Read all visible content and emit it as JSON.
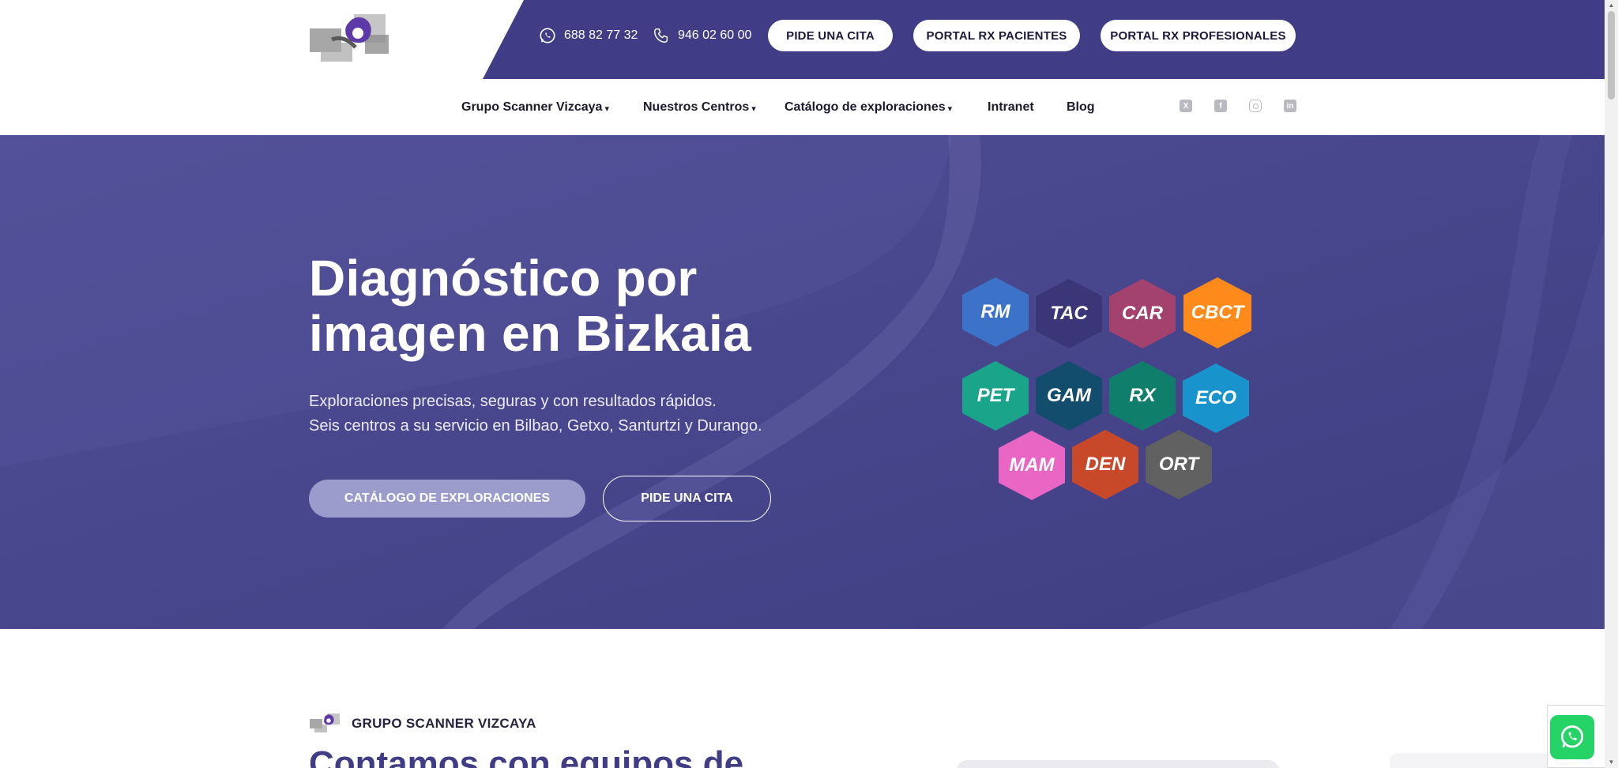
{
  "header": {
    "whatsapp_phone": "688 82 77 32",
    "phone": "946 02 60 00",
    "buttons": {
      "cita": "PIDE UNA CITA",
      "portal_pacientes": "PORTAL RX PACIENTES",
      "portal_profesionales": "PORTAL RX PROFESIONALES"
    }
  },
  "nav": {
    "items": [
      {
        "label": "Grupo Scanner Vizcaya",
        "dropdown": true
      },
      {
        "label": "Nuestros Centros",
        "dropdown": true
      },
      {
        "label": "Catálogo de exploraciones",
        "dropdown": true
      },
      {
        "label": "Intranet",
        "dropdown": false
      },
      {
        "label": "Blog",
        "dropdown": false
      }
    ],
    "social": [
      "x-icon",
      "facebook-icon",
      "instagram-icon",
      "linkedin-icon"
    ]
  },
  "hero": {
    "title_line1": "Diagnóstico por",
    "title_line2": "imagen en Bizkaia",
    "subtitle_line1": "Exploraciones precisas, seguras y con resultados rápidos.",
    "subtitle_line2": "Seis centros a su servicio en Bilbao, Getxo, Santurtzi y Durango.",
    "btn_catalog": "CATÁLOGO DE EXPLORACIONES",
    "btn_cita": "PIDE UNA CITA",
    "modalities": [
      {
        "code": "RM",
        "color": "#3c73c9"
      },
      {
        "code": "TAC",
        "color": "#3a3677"
      },
      {
        "code": "CAR",
        "color": "#a3426f"
      },
      {
        "code": "CBCT",
        "color": "#ff8a1c"
      },
      {
        "code": "PET",
        "color": "#1aa58b"
      },
      {
        "code": "GAM",
        "color": "#124d6e"
      },
      {
        "code": "RX",
        "color": "#0f7e6b"
      },
      {
        "code": "ECO",
        "color": "#1893cc"
      },
      {
        "code": "MAM",
        "color": "#e966c4"
      },
      {
        "code": "DEN",
        "color": "#c8492a"
      },
      {
        "code": "ORT",
        "color": "#616161"
      }
    ]
  },
  "section": {
    "label": "GRUPO SCANNER VIZCAYA",
    "heading": "Contamos con equipos de"
  },
  "colors": {
    "brand": "#403d86",
    "hero_bg": "#474589",
    "whatsapp": "#25d366"
  }
}
